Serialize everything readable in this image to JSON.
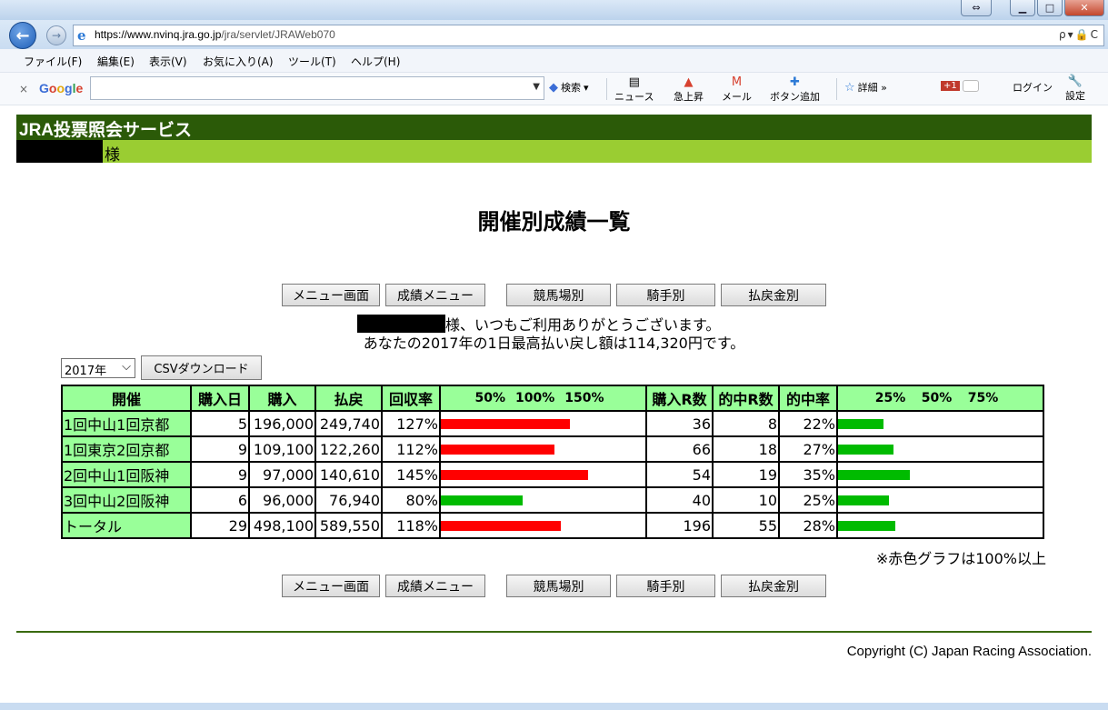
{
  "window": {
    "url_host": "https://www.nvinq.jra.go.jp",
    "url_path": "/jra/servlet/JRAWeb070",
    "addr_tools": "ρ▾🔒C"
  },
  "menubar": [
    "ファイル(F)",
    "編集(E)",
    "表示(V)",
    "お気に入り(A)",
    "ツール(T)",
    "ヘルプ(H)"
  ],
  "google_bar": {
    "close": "×",
    "logo": [
      "G",
      "o",
      "o",
      "g",
      "l",
      "e"
    ],
    "search_label": "検索",
    "news": "ニュース",
    "trending": "急上昇",
    "mail": "メール",
    "add_button": "ボタン追加",
    "details": "詳細 »",
    "plus_one": "+1",
    "login": "ログイン",
    "settings": "設定"
  },
  "header": {
    "title": "JRA投票照会サービス",
    "user_suffix": "様"
  },
  "page_title": "開催別成績一覧",
  "nav_buttons": [
    "メニュー画面",
    "成績メニュー",
    "競馬場別",
    "騎手別",
    "払戻金別"
  ],
  "greeting": {
    "line1_suffix": "様、いつもご利用ありがとうございます。",
    "line2": "あなたの2017年の1日最高払い戻し額は114,320円です。"
  },
  "year_select": {
    "value": "2017年"
  },
  "csv_button": "CSVダウンロード",
  "table": {
    "headers": {
      "kaisai": "開催",
      "days": "購入日",
      "purchase": "購入",
      "payout": "払戻",
      "return_rate": "回収率",
      "return_scale": [
        "50%",
        "100%",
        "150%"
      ],
      "races": "購入R数",
      "hits": "的中R数",
      "hit_rate": "的中率",
      "hit_scale": [
        "25%",
        "50%",
        "75%"
      ]
    },
    "rows": [
      {
        "name": "1回中山1回京都",
        "days": "5",
        "purchase": "196,000",
        "payout": "249,740",
        "return_rate": "127%",
        "return_value": 127,
        "races": "36",
        "hits": "8",
        "hit_rate": "22%",
        "hit_value": 22
      },
      {
        "name": "1回東京2回京都",
        "days": "9",
        "purchase": "109,100",
        "payout": "122,260",
        "return_rate": "112%",
        "return_value": 112,
        "races": "66",
        "hits": "18",
        "hit_rate": "27%",
        "hit_value": 27
      },
      {
        "name": "2回中山1回阪神",
        "days": "9",
        "purchase": "97,000",
        "payout": "140,610",
        "return_rate": "145%",
        "return_value": 145,
        "races": "54",
        "hits": "19",
        "hit_rate": "35%",
        "hit_value": 35
      },
      {
        "name": "3回中山2回阪神",
        "days": "6",
        "purchase": "96,000",
        "payout": "76,940",
        "return_rate": "80%",
        "return_value": 80,
        "races": "40",
        "hits": "10",
        "hit_rate": "25%",
        "hit_value": 25
      },
      {
        "name": "トータル",
        "days": "29",
        "purchase": "498,100",
        "payout": "589,550",
        "return_rate": "118%",
        "return_value": 118,
        "races": "196",
        "hits": "55",
        "hit_rate": "28%",
        "hit_value": 28
      }
    ]
  },
  "note": "※赤色グラフは100%以上",
  "copyright": "Copyright (C) Japan Racing Association.",
  "colors": {
    "banner": "#2b5a08",
    "userbar": "#9acd32",
    "header_cell": "#99ff99",
    "bar_over": "#ff0000",
    "bar_under": "#00bb00"
  }
}
